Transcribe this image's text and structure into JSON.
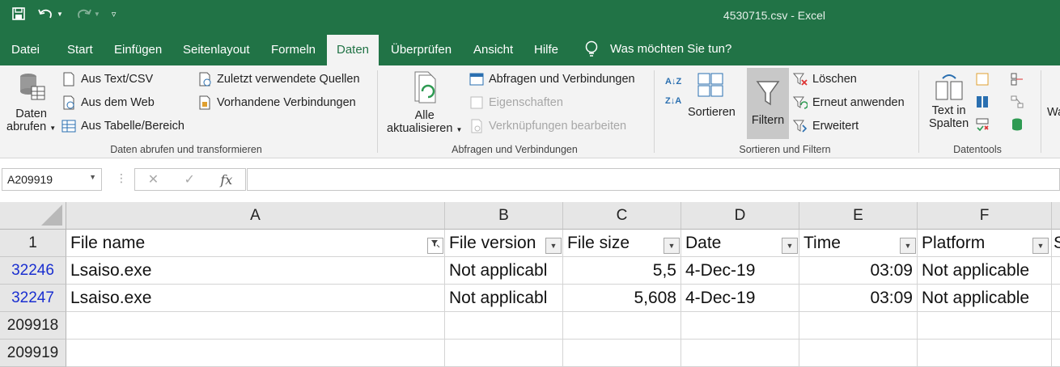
{
  "window": {
    "title": "4530715.csv  -  Excel"
  },
  "tabs": [
    "Datei",
    "Start",
    "Einfügen",
    "Seitenlayout",
    "Formeln",
    "Daten",
    "Überprüfen",
    "Ansicht",
    "Hilfe"
  ],
  "tell_me": "Was möchten Sie tun?",
  "ribbon": {
    "get_data": {
      "line1": "Daten",
      "line2": "abrufen"
    },
    "from_text": "Aus Text/CSV",
    "from_web": "Aus dem Web",
    "from_table": "Aus Tabelle/Bereich",
    "recent_sources": "Zuletzt verwendete Quellen",
    "existing_connections": "Vorhandene Verbindungen",
    "group1": "Daten abrufen und transformieren",
    "refresh": {
      "line1": "Alle",
      "line2": "aktualisieren"
    },
    "queries": "Abfragen und Verbindungen",
    "properties": "Eigenschaften",
    "edit_links": "Verknüpfungen bearbeiten",
    "group2": "Abfragen und Verbindungen",
    "sort": "Sortieren",
    "filter": "Filtern",
    "clear": "Löschen",
    "reapply": "Erneut anwenden",
    "advanced": "Erweitert",
    "group3": "Sortieren und Filtern",
    "text_to_columns": {
      "line1": "Text in",
      "line2": "Spalten"
    },
    "group4": "Datentools",
    "cut_off": "Wa"
  },
  "formula_bar": {
    "name_box": "A209919",
    "fx": "fx",
    "formula": ""
  },
  "columns": [
    "A",
    "B",
    "C",
    "D",
    "E",
    "F"
  ],
  "headers": [
    "File name",
    "File version",
    "File size",
    "Date",
    "Time",
    "Platform",
    "S"
  ],
  "rows": [
    {
      "num": "1",
      "cells": []
    },
    {
      "num": "32246",
      "cells": [
        "Lsaiso.exe",
        "Not applicabl",
        "5,5",
        "4-Dec-19",
        "03:09",
        "Not applicable"
      ]
    },
    {
      "num": "32247",
      "cells": [
        "Lsaiso.exe",
        "Not applicabl",
        "5,608",
        "4-Dec-19",
        "03:09",
        "Not applicable"
      ]
    },
    {
      "num": "209918",
      "cells": []
    },
    {
      "num": "209919",
      "cells": []
    }
  ],
  "colors": {
    "excel_green": "#217346",
    "filtered_row": "#1a2fd0"
  }
}
